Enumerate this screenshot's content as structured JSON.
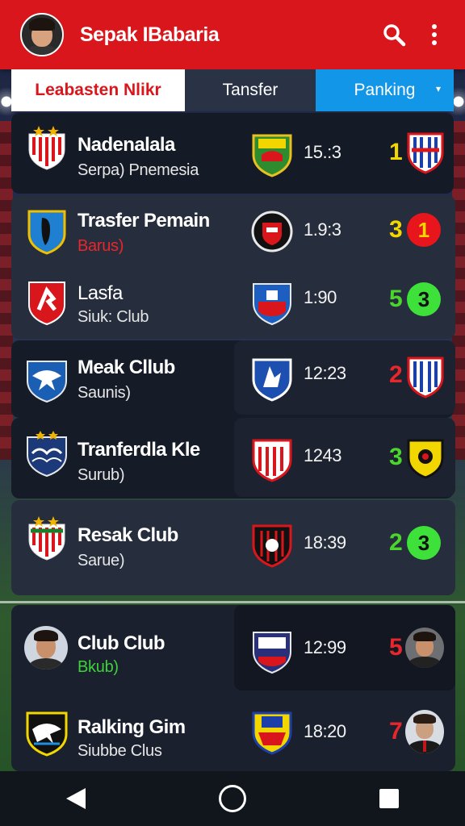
{
  "app": {
    "title": "Sepak IBabaria"
  },
  "tabs": [
    {
      "label": "Leabasten Nlikr"
    },
    {
      "label": "Tansfer"
    },
    {
      "label": "Panking"
    }
  ],
  "rows": [
    {
      "name": "Nadenalala",
      "sub": "Serpa) Pnemesia",
      "time": "15.:3",
      "rank": "1",
      "sub_color": "#e6e6e6",
      "rank_color": "#f2d600",
      "badge": ""
    },
    {
      "name": "Trasfer Pemain",
      "sub": "Barus)",
      "time": "1.9:3",
      "rank": "3",
      "sub_color": "#e8262b",
      "rank_color": "#f2d600",
      "badge": "1",
      "badge_color": "#e8161c"
    },
    {
      "name": "Lasfa",
      "sub": "Siuk: Club",
      "time": "1:90",
      "rank": "5",
      "sub_color": "#e6e6e6",
      "rank_color": "#4ad62a",
      "badge": "3",
      "badge_color": "#3ee03a"
    },
    {
      "name": "Meak Cllub",
      "sub": "Saunis)",
      "time": "12:23",
      "rank": "2",
      "sub_color": "#e6e6e6",
      "rank_color": "#e8262b",
      "badge": ""
    },
    {
      "name": "Tranferdla Kle",
      "sub": "Surub)",
      "time": "1243",
      "rank": "3",
      "sub_color": "#e6e6e6",
      "rank_color": "#4ad62a",
      "badge": ""
    },
    {
      "name": "Resak Club",
      "sub": "Sarue)",
      "time": "18:39",
      "rank": "2",
      "sub_color": "#e6e6e6",
      "rank_color": "#4ad62a",
      "badge": "3",
      "badge_color": "#3ee03a"
    },
    {
      "name": "Club Club",
      "sub": "Bkub)",
      "time": "12:99",
      "rank": "5",
      "sub_color": "#3ed23a",
      "rank_color": "#e8262b",
      "badge": ""
    },
    {
      "name": "Ralking Gim",
      "sub": "Siubbe Clus",
      "time": "18:20",
      "rank": "7",
      "sub_color": "#e6e6e6",
      "rank_color": "#e8262b",
      "badge": ""
    }
  ],
  "colors": {
    "appbar": "#d9161c",
    "tab_active": "#ffffff",
    "tab_ranking": "#1296e8"
  },
  "icons": [
    "search-icon",
    "more-vert-icon",
    "chevron-down-icon",
    "nav-back-icon",
    "nav-home-icon",
    "nav-recents-icon"
  ]
}
